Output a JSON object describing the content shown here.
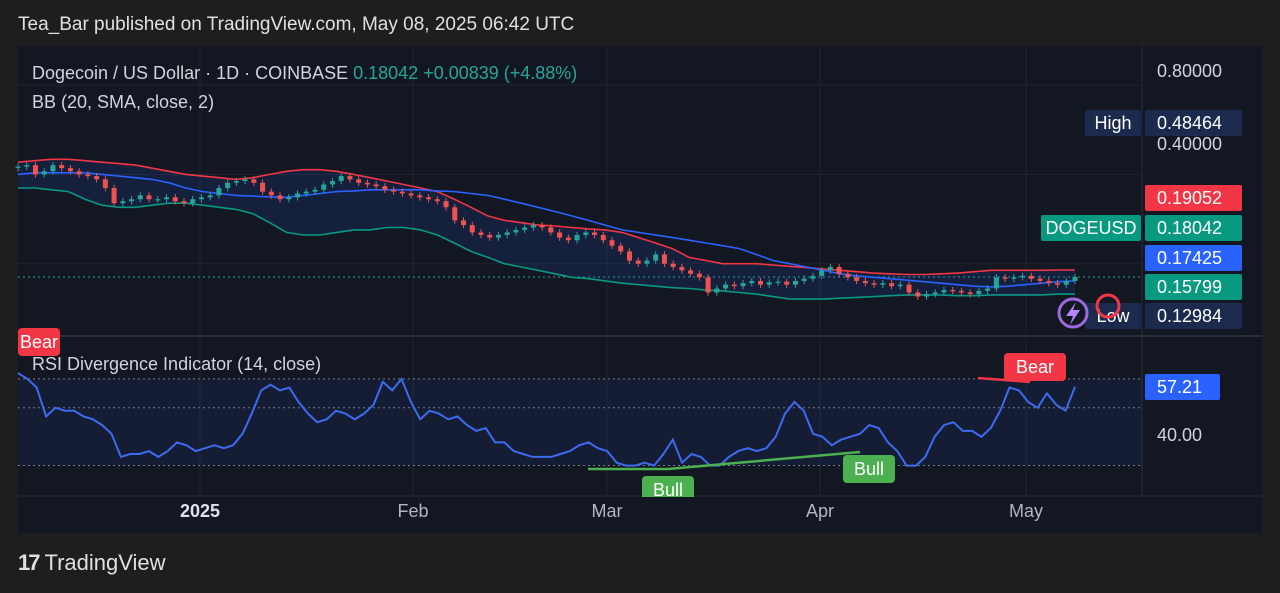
{
  "publish_line": "Tea_Bar published on TradingView.com, May 08, 2025 06:42 UTC",
  "brand": {
    "name": "TradingView",
    "logo_text": "17"
  },
  "colors": {
    "up": "#26a69a",
    "down": "#ef5350",
    "basis": "#2962ff",
    "upper": "#f23645",
    "lower": "#089981",
    "rsi": "#3d6bf0",
    "bull": "#4caf50",
    "bear": "#f23645",
    "navy": "#1c2b4d"
  },
  "chart_data": [
    {
      "type": "candlestick",
      "legend": {
        "symbol": "Dogecoin / US Dollar · 1D · COINBASE",
        "price": "0.18042",
        "change": "+0.00839 (+4.88%)"
      },
      "indicator_label": "BB (20, SMA, close, 2)",
      "y_scale": "log",
      "ylim": [
        0.115,
        0.9
      ],
      "y_ticks": [
        "0.80000",
        "0.40000"
      ],
      "x_ticks": [
        "2025",
        "Feb",
        "Mar",
        "Apr",
        "May"
      ],
      "price_labels": [
        {
          "name": "High",
          "value": "0.48464",
          "kind": "high"
        },
        {
          "name": "",
          "value": "0.19052",
          "kind": "upper"
        },
        {
          "name": "DOGEUSD",
          "value": "0.18042",
          "kind": "last"
        },
        {
          "name": "",
          "value": "0.17425",
          "kind": "basis"
        },
        {
          "name": "",
          "value": "0.15799",
          "kind": "lower"
        },
        {
          "name": "Low",
          "value": "0.12984",
          "kind": "low"
        }
      ],
      "series": [
        {
          "name": "close",
          "values": [
            0.425,
            0.43,
            0.4,
            0.41,
            0.43,
            0.42,
            0.41,
            0.4,
            0.395,
            0.385,
            0.36,
            0.32,
            0.325,
            0.33,
            0.34,
            0.33,
            0.33,
            0.335,
            0.325,
            0.32,
            0.33,
            0.335,
            0.34,
            0.36,
            0.375,
            0.38,
            0.385,
            0.375,
            0.35,
            0.34,
            0.33,
            0.335,
            0.345,
            0.35,
            0.355,
            0.37,
            0.38,
            0.395,
            0.385,
            0.375,
            0.37,
            0.365,
            0.355,
            0.35,
            0.345,
            0.34,
            0.335,
            0.33,
            0.325,
            0.31,
            0.28,
            0.27,
            0.255,
            0.25,
            0.245,
            0.25,
            0.255,
            0.26,
            0.265,
            0.27,
            0.265,
            0.255,
            0.245,
            0.24,
            0.25,
            0.255,
            0.25,
            0.24,
            0.23,
            0.22,
            0.205,
            0.2,
            0.205,
            0.215,
            0.2,
            0.195,
            0.19,
            0.185,
            0.18,
            0.16,
            0.165,
            0.17,
            0.168,
            0.172,
            0.175,
            0.17,
            0.173,
            0.174,
            0.17,
            0.175,
            0.178,
            0.182,
            0.19,
            0.195,
            0.185,
            0.18,
            0.175,
            0.172,
            0.17,
            0.172,
            0.168,
            0.17,
            0.16,
            0.155,
            0.158,
            0.16,
            0.163,
            0.162,
            0.16,
            0.158,
            0.162,
            0.165,
            0.18,
            0.178,
            0.18,
            0.182,
            0.178,
            0.175,
            0.172,
            0.17,
            0.175,
            0.18042
          ]
        },
        {
          "name": "BB basis",
          "values": [
            0.4,
            0.405,
            0.405,
            0.405,
            0.405,
            0.4,
            0.395,
            0.39,
            0.385,
            0.375,
            0.36,
            0.35,
            0.345,
            0.34,
            0.338,
            0.336,
            0.335,
            0.34,
            0.345,
            0.35,
            0.352,
            0.355,
            0.355,
            0.355,
            0.355,
            0.352,
            0.35,
            0.345,
            0.34,
            0.33,
            0.32,
            0.31,
            0.3,
            0.29,
            0.28,
            0.27,
            0.26,
            0.255,
            0.25,
            0.245,
            0.24,
            0.235,
            0.23,
            0.225,
            0.215,
            0.205,
            0.2,
            0.195,
            0.19,
            0.185,
            0.182,
            0.18,
            0.178,
            0.176,
            0.174,
            0.172,
            0.17,
            0.168,
            0.167,
            0.168,
            0.17,
            0.172,
            0.174,
            0.175
          ]
        },
        {
          "name": "BB upper",
          "values": [
            0.44,
            0.445,
            0.45,
            0.45,
            0.445,
            0.44,
            0.435,
            0.43,
            0.42,
            0.41,
            0.4,
            0.395,
            0.39,
            0.385,
            0.39,
            0.4,
            0.41,
            0.415,
            0.415,
            0.41,
            0.4,
            0.39,
            0.38,
            0.37,
            0.36,
            0.35,
            0.33,
            0.31,
            0.29,
            0.28,
            0.275,
            0.27,
            0.268,
            0.265,
            0.262,
            0.26,
            0.255,
            0.245,
            0.235,
            0.225,
            0.21,
            0.205,
            0.2,
            0.2,
            0.2,
            0.198,
            0.196,
            0.194,
            0.192,
            0.19,
            0.188,
            0.186,
            0.185,
            0.184,
            0.184,
            0.185,
            0.186,
            0.188,
            0.19,
            0.19,
            0.19,
            0.19,
            0.19052,
            0.19052
          ]
        },
        {
          "name": "BB lower",
          "values": [
            0.36,
            0.36,
            0.355,
            0.35,
            0.33,
            0.315,
            0.31,
            0.31,
            0.315,
            0.32,
            0.32,
            0.315,
            0.31,
            0.305,
            0.295,
            0.275,
            0.255,
            0.25,
            0.25,
            0.255,
            0.26,
            0.26,
            0.265,
            0.265,
            0.26,
            0.25,
            0.235,
            0.22,
            0.21,
            0.2,
            0.195,
            0.19,
            0.185,
            0.18,
            0.178,
            0.175,
            0.172,
            0.17,
            0.168,
            0.166,
            0.165,
            0.163,
            0.162,
            0.16,
            0.158,
            0.155,
            0.152,
            0.152,
            0.152,
            0.153,
            0.154,
            0.155,
            0.156,
            0.157,
            0.157,
            0.157,
            0.156,
            0.156,
            0.157,
            0.157,
            0.157,
            0.157,
            0.158,
            0.158
          ]
        }
      ]
    },
    {
      "type": "line",
      "title": "RSI Divergence Indicator (14, close)",
      "ylim": [
        25,
        70
      ],
      "y_ticks": [
        "40.00"
      ],
      "last_value": "57.21",
      "series": [
        {
          "name": "RSI",
          "values": [
            62,
            60,
            57,
            47,
            50,
            49,
            49,
            47,
            46,
            44,
            41,
            33,
            34,
            34,
            35,
            33,
            35,
            38,
            37,
            35,
            36,
            37,
            36,
            37,
            41,
            48,
            56,
            58,
            56,
            57,
            52,
            48,
            45,
            46,
            49,
            48,
            46,
            48,
            51,
            59,
            56,
            60,
            52,
            46,
            49,
            48,
            46,
            47,
            44,
            42,
            43,
            38,
            38,
            35,
            34,
            33,
            33,
            33,
            34,
            35,
            37,
            38,
            36,
            35,
            31,
            30,
            30,
            31,
            30,
            34,
            39,
            31,
            34,
            33,
            30,
            30,
            33,
            35,
            36,
            35,
            36,
            40,
            48,
            52,
            49,
            41,
            40,
            37,
            39,
            40,
            41,
            44,
            43,
            38,
            35,
            30,
            30,
            33,
            40,
            44,
            45,
            42,
            42,
            40,
            43,
            49,
            57,
            56,
            52,
            50,
            55,
            51,
            49,
            57.21
          ]
        }
      ],
      "divergences": [
        {
          "label": "Bear",
          "kind": "top-left"
        },
        {
          "label": "Bull",
          "kind": "mid"
        },
        {
          "label": "Bull",
          "kind": "right"
        },
        {
          "label": "Bear",
          "kind": "top-right"
        }
      ]
    }
  ]
}
